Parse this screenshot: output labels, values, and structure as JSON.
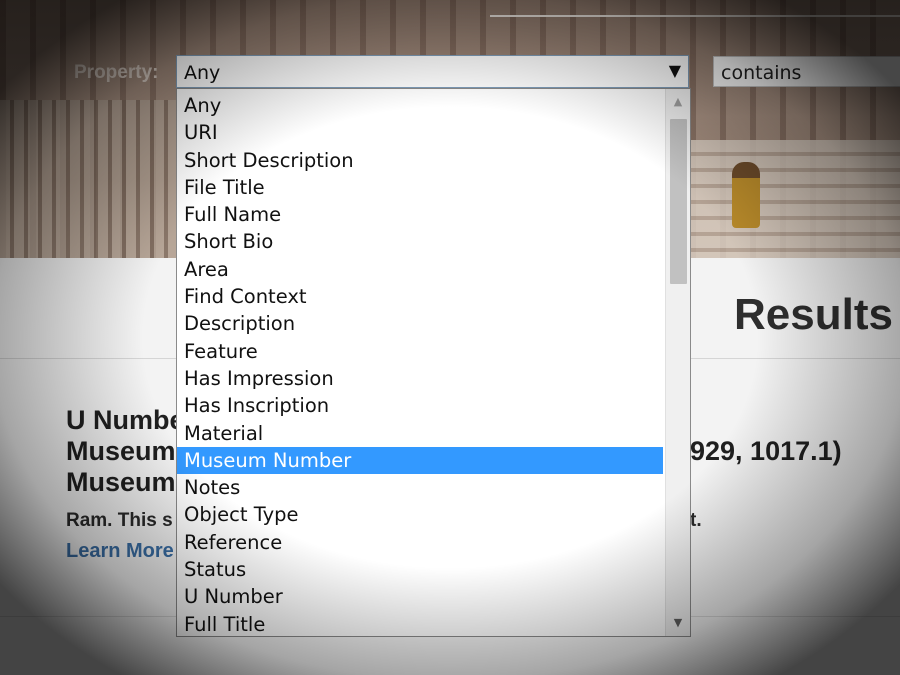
{
  "search": {
    "property_label": "Property:",
    "property_value": "Any",
    "operator_value": "contains"
  },
  "dropdown": {
    "options": [
      "Any",
      "URI",
      "Short Description",
      "File Title",
      "Full Name",
      "Short Bio",
      "Area",
      "Find Context",
      "Description",
      "Feature",
      "Has Impression",
      "Has Inscription",
      "Material",
      "Museum Number",
      "Notes",
      "Object Type",
      "Reference",
      "Status",
      "U Number",
      "Full Title"
    ],
    "selected": "Museum Number"
  },
  "results": {
    "title": "Results",
    "item": {
      "heading_line1": "U Numbe",
      "heading_line2": "Museum",
      "heading_line2_tail": "929, 1017.1)",
      "heading_line3": "Museum",
      "summary": "Ram. This s",
      "summary_tail": "t.",
      "learn_more": "Learn More"
    }
  },
  "colors": {
    "selection": "#3399ff",
    "link": "#3a6ea5"
  }
}
